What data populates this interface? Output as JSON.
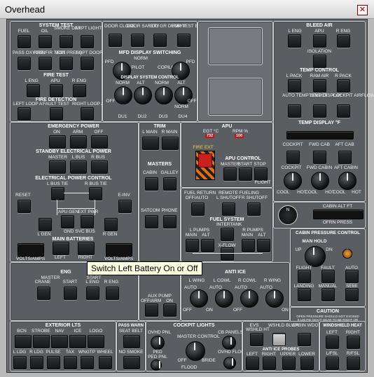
{
  "window": {
    "title": "Overhead",
    "close_glyph": "✕"
  },
  "tooltip": "Switch Left Battery On or Off",
  "system_test": {
    "title": "SYSTEM TEST",
    "buttons": [
      "FUEL",
      "OIL",
      "SMOKE DET",
      "ARPT LIGHTS",
      "PASS OXYGEN",
      "FIRE/FIR TEST",
      "MON PRESS",
      "EQPT DOOR"
    ]
  },
  "fire_test": {
    "title": "FIRE TEST",
    "labels": [
      "L ENG",
      "APU",
      "R ENG"
    ]
  },
  "fire_detection": {
    "title": "FIRE DETECTION",
    "labels": [
      "LEFT LOOP A",
      "FAULT TEST",
      "RIGHT LOOP A"
    ]
  },
  "doors": {
    "labels": [
      "DOOR CLOSE",
      "DOOR SAFETY",
      "LDG GR DUMP V",
      "FDR/TEST EVENT"
    ]
  },
  "mfd_display": {
    "title": "MFD DISPLAY SWITCHING",
    "labels": [
      "PFD",
      "NORM",
      "PILOT",
      "COPILOT",
      "PFD"
    ],
    "knobs": [
      "PILOT",
      "COPILOT"
    ]
  },
  "display_source": {
    "title": "DISPLAY SYSTEM CONTROL",
    "labels": [
      "NORM",
      "OFF",
      "ALT",
      "NORM",
      "ALT",
      "NORM",
      "OFF"
    ],
    "knobs": [
      "DU1",
      "DU2",
      "DU3",
      "DU4"
    ]
  },
  "bleed_air": {
    "title": "BLEED AIR",
    "labels": [
      "L ENG",
      "APU",
      "R ENG",
      "ISOLATION"
    ]
  },
  "temp_control": {
    "title": "TEMP CONTROL",
    "buttons": [
      "L PACK",
      "RAM AIR",
      "R PACK",
      "AUTO TEMP SELECT",
      "TEMP DISPLAY",
      "COCKPIT AIRFLOW"
    ]
  },
  "temp_display": {
    "title": "TEMP DISPLAY °F",
    "labels": [
      "COCKPIT",
      "FWD CAB",
      "AFT CAB"
    ],
    "knob_labels": [
      "COCKPIT",
      "FWD CABIN",
      "AFT CABIN"
    ],
    "knob_scale": [
      "COOL",
      "HOT"
    ]
  },
  "emergency_power": {
    "title": "EMERGENCY POWER",
    "labels": [
      "ON",
      "ARM",
      "OFF"
    ]
  },
  "standby_power": {
    "title": "STANDBY ELECTRICAL POWER",
    "labels": [
      "MASTER",
      "L BUS",
      "R BUS"
    ]
  },
  "elec_control": {
    "title": "ELECTRICAL POWER CONTROL",
    "labels": [
      "L BUS TIE",
      "R BUS TIE",
      "RESET",
      "E-INV",
      "L GEN",
      "APU GEN",
      "EXT PWR",
      "R GEN",
      "GND SVC BUS"
    ]
  },
  "main_batteries": {
    "title": "MAIN BATTERIES",
    "labels": [
      "VOLTS/AMPS",
      "LEFT",
      "RIGHT",
      "VOLTS/AMPS"
    ]
  },
  "trim": {
    "title": "TRIM",
    "labels": [
      "L MAIN",
      "R MAIN"
    ]
  },
  "masters": {
    "title": "MASTERS",
    "labels": [
      "CABIN",
      "GALLEY",
      "SATCOM",
      "PHONE"
    ]
  },
  "apu": {
    "title": "APU",
    "indicators": [
      {
        "label": "EGT °C",
        "value": "732",
        "color": "#c01818"
      },
      {
        "label": "RPM %",
        "value": "100",
        "color": "#c01818"
      }
    ],
    "fire_ext": "FIRE EXT",
    "control_title": "APU CONTROL",
    "labels": [
      "MASTER",
      "START",
      "STOP"
    ],
    "extra": "FLIGHT"
  },
  "fuel": {
    "return_label": "FUEL RETURN",
    "fueling_label": "REMOTE FUELING",
    "labels": [
      "OFF/AUTO",
      "L SHUTOFF",
      "R SHUTOFF"
    ],
    "system_title": "FUEL SYSTEM",
    "pumps": [
      "L PUMPS",
      "MAIN",
      "ALT",
      "R PUMPS",
      "MAIN",
      "ALT",
      "INTERTANK",
      "X-FLOW"
    ]
  },
  "clock": {
    "label": "CABIN ALT FT",
    "value": "OFRN PRESS",
    "compass": "N"
  },
  "cabin_pressure": {
    "title": "CABIN PRESSURE CONTROL",
    "knob_title": "MAN HOLD",
    "labels": [
      "UP",
      "DN",
      "FLIGHT",
      "FAULT",
      "AUTO",
      "LANDING",
      "MANUAL",
      "SEMI"
    ]
  },
  "caution": {
    "title": "CAUTION",
    "text": "OPEN PRESSURE SHOULD NOT EXCEED 0.125 PSI (SHUT GEAR TO BE RIGHT OR LANDING)"
  },
  "engine_start": {
    "title": "ENG",
    "labels": [
      "MASTER",
      "START",
      "CRANE",
      "START",
      "L ENG",
      "R ENG"
    ]
  },
  "anti_ice": {
    "title": "ANTI ICE",
    "labels": [
      "L WING",
      "L COWL",
      "R COWL",
      "R WING"
    ],
    "knob_scale": [
      "AUTO",
      "OFF",
      "ON"
    ]
  },
  "aux": {
    "labels": [
      "OFF/ARM",
      "ON",
      "AUX PUMP"
    ]
  },
  "exterior_lts": {
    "title": "EXTERIOR LTS",
    "buttons": [
      "BCN",
      "STROBE",
      "NAV",
      "ICE",
      "LOGO",
      "L LDG",
      "R LDG",
      "PULSE",
      "TAX",
      "WNGTP",
      "WHEEL"
    ]
  },
  "pass_warn": {
    "title": "PASS WARN",
    "labels": [
      "SEAT BELT",
      "NO SMOKE"
    ]
  },
  "cockpit_lights": {
    "title": "COCKPIT LIGHTS",
    "labels": [
      "OVHD PNL",
      "CB PANELS",
      "MASTER CONTROL",
      "PED",
      "PED PNL",
      "FLOOD",
      "OFF",
      "BRIDE",
      "OVHD FLOOD"
    ]
  },
  "windshield": {
    "title": "WINDSHIELD HEAT",
    "labels": [
      "LEFT",
      "RIGHT",
      "L/FSL",
      "R/FSL"
    ]
  },
  "antiice_misc": {
    "title": "ANTI ICE PROBES",
    "labels": [
      "EVS",
      "WSHLD HT",
      "WSHLD BLWR",
      "CABIN WDO HT",
      "LEFT",
      "RIGHT",
      "UPPER",
      "LOWER"
    ]
  },
  "colors": {
    "panel": "#5e6266",
    "frame": "#c9cbcf",
    "fire_red": "#c8201c",
    "amber": "#e07010"
  }
}
